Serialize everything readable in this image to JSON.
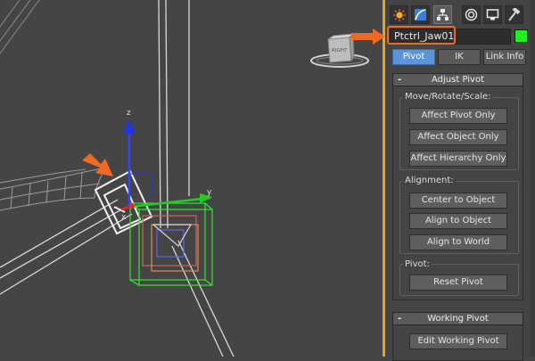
{
  "command_panel": {
    "tabs": [
      {
        "icon": "sun-icon"
      },
      {
        "icon": "modify-curve-icon"
      },
      {
        "icon": "hierarchy-icon"
      },
      {
        "icon": "motion-icon"
      },
      {
        "icon": "display-icon"
      },
      {
        "icon": "utilities-hammer-icon"
      }
    ],
    "active_tab": "hierarchy",
    "object_name": "Ptctrl_Jaw01",
    "object_color": "#22ee22",
    "highlight_color": "#ee6a22",
    "mode_tabs": [
      {
        "label": "Pivot",
        "active": true
      },
      {
        "label": "IK",
        "active": false
      },
      {
        "label": "Link Info",
        "active": false
      }
    ]
  },
  "adjust_pivot": {
    "collapse_symbol": "-",
    "title": "Adjust Pivot",
    "move_group": {
      "title": "Move/Rotate/Scale:",
      "buttons": [
        "Affect Pivot Only",
        "Affect Object Only",
        "Affect Hierarchy Only"
      ]
    },
    "alignment_group": {
      "title": "Alignment:",
      "buttons": [
        "Center to Object",
        "Align to Object",
        "Align to World"
      ]
    },
    "pivot_group": {
      "title": "Pivot:",
      "buttons": [
        "Reset Pivot"
      ]
    }
  },
  "working_pivot": {
    "collapse_symbol": "-",
    "title": "Working Pivot",
    "buttons": [
      "Edit Working Pivot"
    ]
  },
  "viewport": {
    "viewcube_label": "RIGHT",
    "axis_labels": {
      "x": "x",
      "y": "y",
      "z": "z"
    },
    "annotation_arrow_color": "#ee6a22"
  }
}
